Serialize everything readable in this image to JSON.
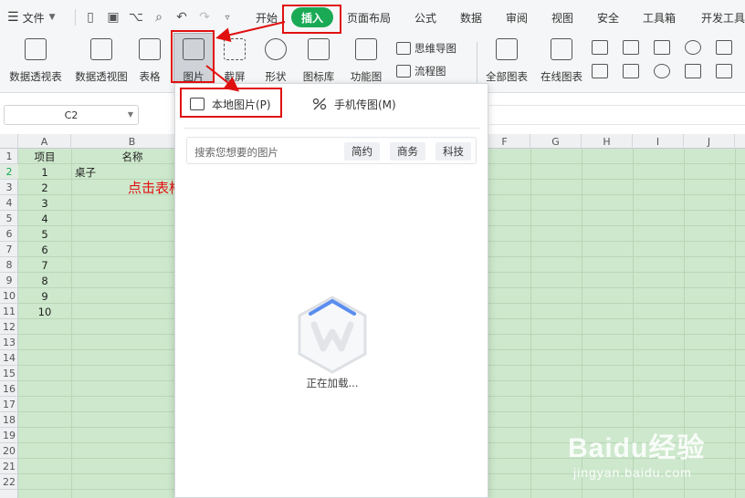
{
  "menubar": {
    "file_label": "文件",
    "tabs": [
      {
        "label": "开始"
      },
      {
        "label": "插入"
      },
      {
        "label": "页面布局"
      },
      {
        "label": "公式"
      },
      {
        "label": "数据"
      },
      {
        "label": "审阅"
      },
      {
        "label": "视图"
      },
      {
        "label": "安全"
      },
      {
        "label": "工具箱"
      },
      {
        "label": "开发工具"
      }
    ],
    "active_tab": "插入"
  },
  "ribbon": {
    "buttons": [
      {
        "label": "数据透视表",
        "icon": "pivot-table-icon"
      },
      {
        "label": "数据透视图",
        "icon": "pivot-chart-icon"
      },
      {
        "label": "表格",
        "icon": "table-icon"
      },
      {
        "label": "图片",
        "icon": "picture-icon"
      },
      {
        "label": "截屏",
        "icon": "screenshot-icon"
      },
      {
        "label": "形状",
        "icon": "shapes-icon"
      },
      {
        "label": "图标库",
        "icon": "icon-library-icon"
      },
      {
        "label": "功能图",
        "icon": "function-chart-icon"
      }
    ],
    "small_buttons": [
      {
        "label": "思维导图",
        "icon": "mindmap-icon"
      },
      {
        "label": "流程图",
        "icon": "flowchart-icon"
      }
    ],
    "chart_buttons": [
      {
        "label": "全部图表",
        "icon": "all-charts-icon"
      },
      {
        "label": "在线图表",
        "icon": "online-chart-icon"
      }
    ]
  },
  "namebox": {
    "value": "C2"
  },
  "columns": [
    "A",
    "B",
    "F",
    "G",
    "H",
    "I",
    "J"
  ],
  "rows": [
    "1",
    "2",
    "3",
    "4",
    "5",
    "6",
    "7",
    "8",
    "9",
    "10",
    "11",
    "12",
    "13",
    "14",
    "15",
    "16",
    "17",
    "18",
    "19",
    "20",
    "21",
    "22"
  ],
  "table": {
    "header": {
      "a": "项目",
      "b": "名称"
    },
    "rows": [
      {
        "a": "1",
        "b": "桌子"
      },
      {
        "a": "2",
        "b": ""
      },
      {
        "a": "3",
        "b": ""
      },
      {
        "a": "4",
        "b": ""
      },
      {
        "a": "5",
        "b": ""
      },
      {
        "a": "6",
        "b": ""
      },
      {
        "a": "7",
        "b": ""
      },
      {
        "a": "8",
        "b": ""
      },
      {
        "a": "9",
        "b": ""
      },
      {
        "a": "10",
        "b": ""
      }
    ]
  },
  "annotation": "点击表格‘菜单栏’—‘插入’—‘图片’—‘本地图片’",
  "picture_panel": {
    "local_label": "本地图片(P)",
    "phone_label": "手机传图(M)",
    "search_placeholder": "搜索您想要的图片",
    "chips": [
      "简约",
      "商务",
      "科技"
    ],
    "loading_text": "正在加载..."
  },
  "watermark": {
    "brand": "Baidu经验",
    "url": "jingyan.baidu.com"
  },
  "colors": {
    "accent_green": "#1aaa55",
    "annotation_red": "#e01010",
    "grid_green": "#cde8cc"
  }
}
